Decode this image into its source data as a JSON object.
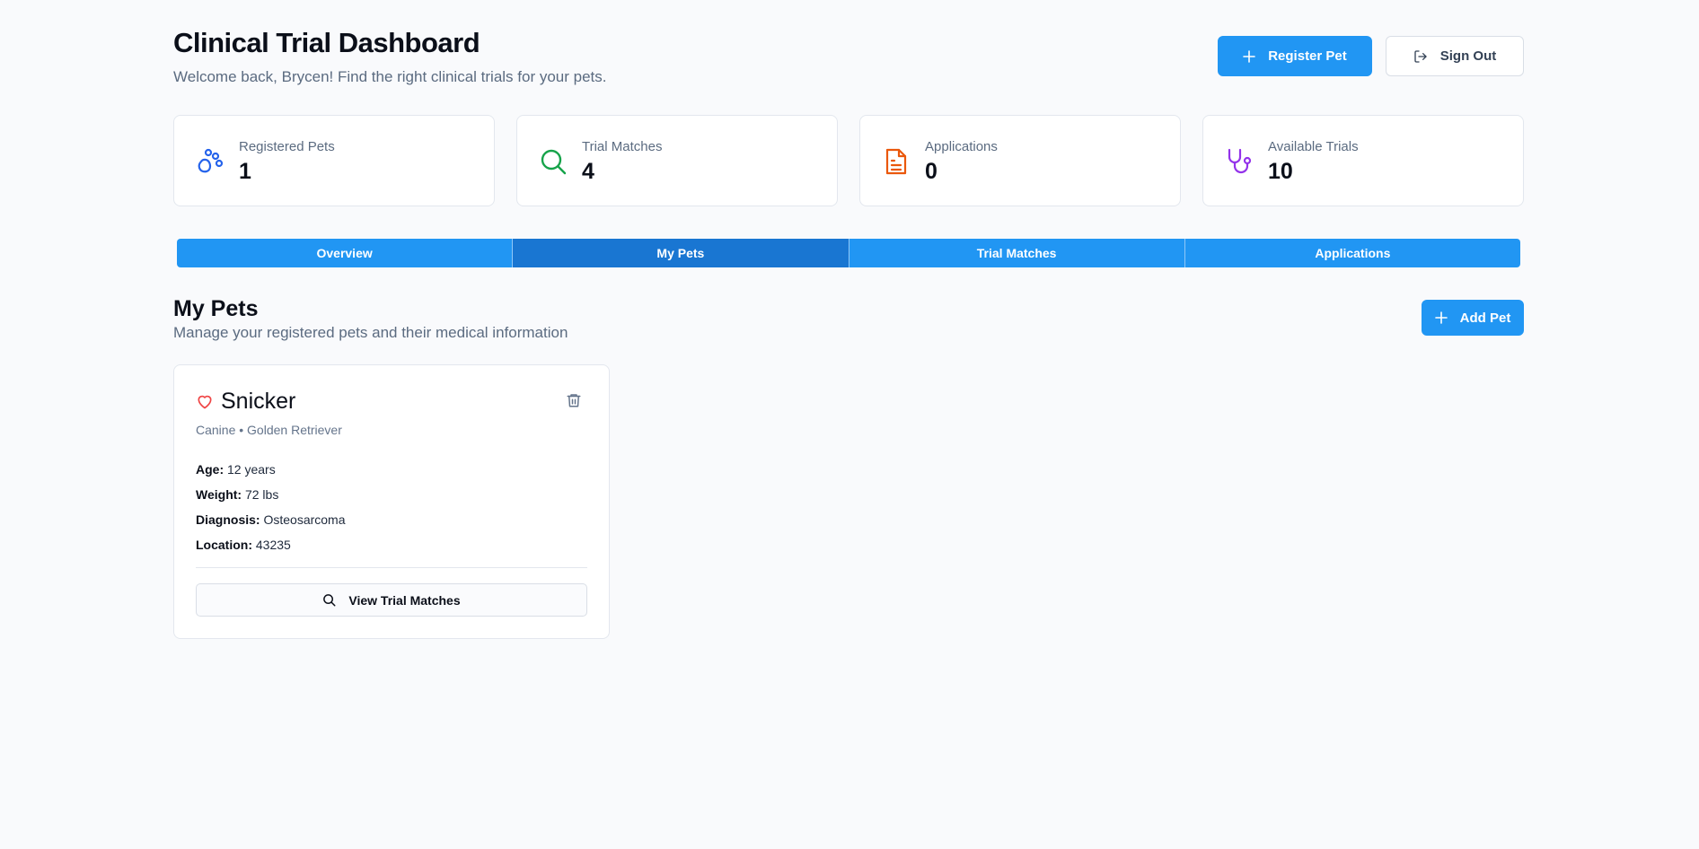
{
  "header": {
    "title": "Clinical Trial Dashboard",
    "welcome": "Welcome back, Brycen! Find the right clinical trials for your pets.",
    "register_label": "Register Pet",
    "signout_label": "Sign Out"
  },
  "stats": [
    {
      "label": "Registered Pets",
      "value": "1",
      "icon": "paw-icon",
      "color": "#2563eb"
    },
    {
      "label": "Trial Matches",
      "value": "4",
      "icon": "search-icon",
      "color": "#16a34a"
    },
    {
      "label": "Applications",
      "value": "0",
      "icon": "document-icon",
      "color": "#ea580c"
    },
    {
      "label": "Available Trials",
      "value": "10",
      "icon": "stethoscope-icon",
      "color": "#9333ea"
    }
  ],
  "tabs": [
    {
      "label": "Overview",
      "active": false
    },
    {
      "label": "My Pets",
      "active": true
    },
    {
      "label": "Trial Matches",
      "active": false
    },
    {
      "label": "Applications",
      "active": false
    }
  ],
  "section": {
    "title": "My Pets",
    "subtitle": "Manage your registered pets and their medical information",
    "add_label": "Add Pet"
  },
  "pet": {
    "name": "Snicker",
    "species_breed": "Canine • Golden Retriever",
    "age_label": "Age:",
    "age": "12 years",
    "weight_label": "Weight:",
    "weight": "72 lbs",
    "diagnosis_label": "Diagnosis:",
    "diagnosis": "Osteosarcoma",
    "location_label": "Location:",
    "location": "43235",
    "view_label": "View Trial Matches"
  },
  "colors": {
    "primary": "#2196f3",
    "tab_active": "#1976d2",
    "heart": "#ef4444"
  }
}
